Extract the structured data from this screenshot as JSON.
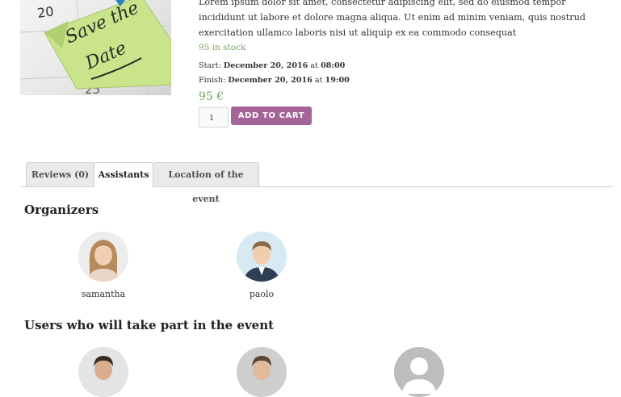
{
  "product": {
    "image_caption_number_top": "20",
    "image_caption_number_bottom": "25",
    "image_note_text_line1": "Save the",
    "image_note_text_line2": "Date",
    "description": "Lorem ipsum dolor sit amet, consectetur adipiscing elit, sed do eiusmod tempor incididunt ut labore et dolore magna aliqua. Ut enim ad minim veniam, quis nostrud exercitation ullamco laboris nisi ut aliquip ex ea commodo consequat",
    "stock": "95 in stock",
    "start_label": "Start:",
    "start_date": "December 20, 2016",
    "start_at": "at",
    "start_time": "08:00",
    "finish_label": "Finish:",
    "finish_date": "December 20, 2016",
    "finish_at": "at",
    "finish_time": "19:00",
    "price": "95 €",
    "quantity": "1",
    "add_to_cart": "ADD TO CART"
  },
  "tabs": [
    {
      "label": "Reviews (0)",
      "active": false
    },
    {
      "label": "Assistants",
      "active": true
    },
    {
      "label": "Location of the event",
      "active": false
    }
  ],
  "organizers": {
    "title": "Organizers",
    "people": [
      {
        "name": "samantha",
        "avatar": "woman-avatar"
      },
      {
        "name": "paolo",
        "avatar": "man-avatar"
      }
    ]
  },
  "participants": {
    "title": "Users who will take part in the event",
    "people": [
      {
        "avatar": "man-avatar"
      },
      {
        "avatar": "man-avatar"
      },
      {
        "avatar": "default-user-avatar"
      }
    ]
  },
  "colors": {
    "accent_purple": "#a46497",
    "price_green": "#77a464",
    "note_green": "#c9e48a"
  }
}
